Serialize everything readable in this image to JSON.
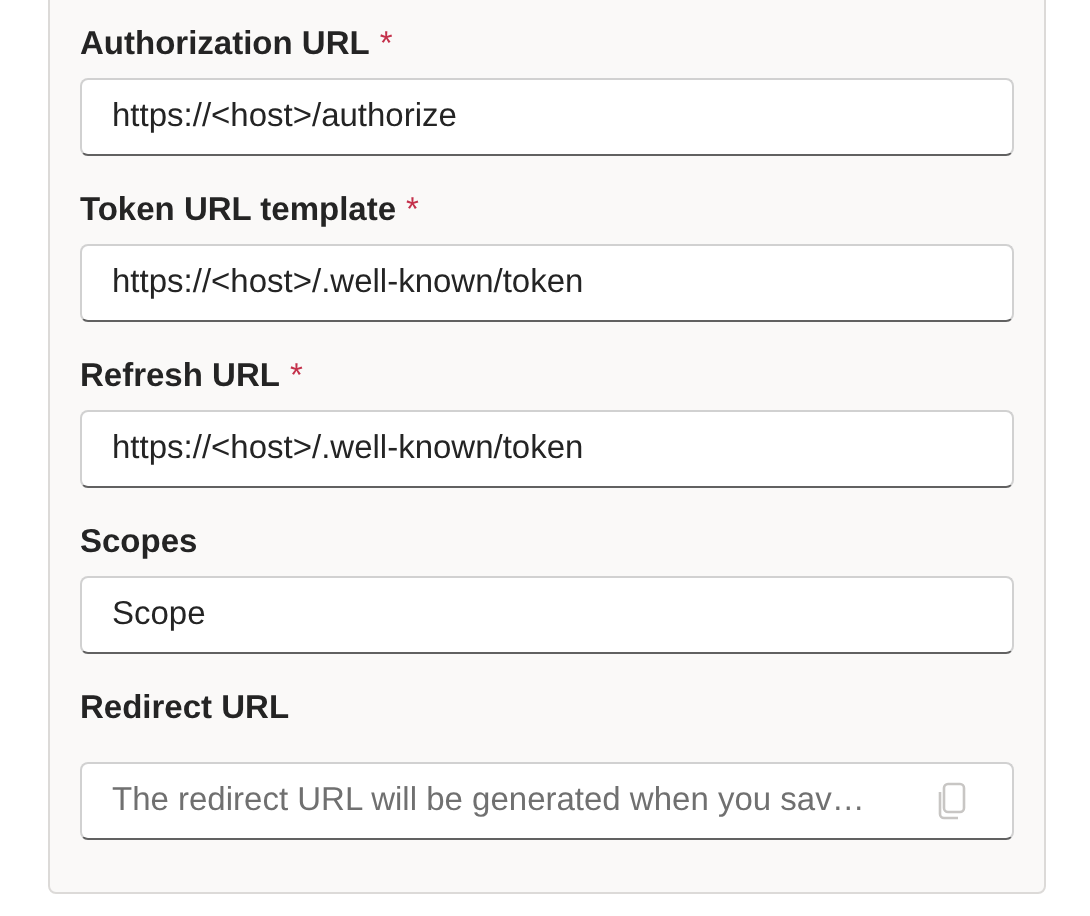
{
  "fields": [
    {
      "label": "Authorization URL",
      "asterisk": "*",
      "kind": "text",
      "value": "https://<host>/authorize"
    },
    {
      "label": "Token URL template",
      "asterisk": "*",
      "kind": "text",
      "value": "https://<host>/.well-known/token"
    },
    {
      "label": "Refresh URL",
      "asterisk": "*",
      "kind": "text",
      "value": "https://<host>/.well-known/token"
    },
    {
      "label": "Scopes",
      "kind": "text",
      "value": "Scope"
    },
    {
      "label": "Redirect URL",
      "kind": "copy",
      "placeholder": "The redirect URL will be generated when you sav…"
    }
  ]
}
